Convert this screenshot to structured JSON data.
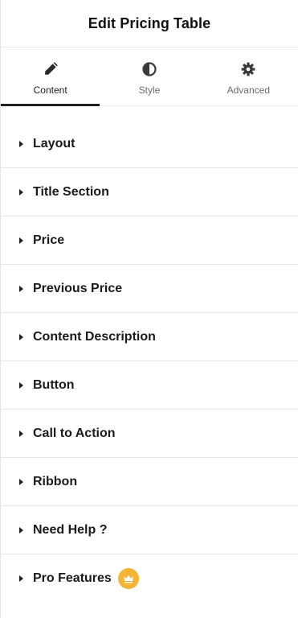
{
  "header": {
    "title": "Edit Pricing Table"
  },
  "tabs": [
    {
      "label": "Content",
      "icon": "pencil-icon",
      "active": true
    },
    {
      "label": "Style",
      "icon": "half-circle-icon",
      "active": false
    },
    {
      "label": "Advanced",
      "icon": "gear-icon",
      "active": false
    }
  ],
  "sections": [
    {
      "label": "Layout"
    },
    {
      "label": "Title Section"
    },
    {
      "label": "Price"
    },
    {
      "label": "Previous Price"
    },
    {
      "label": "Content Description"
    },
    {
      "label": "Button"
    },
    {
      "label": "Call to Action"
    },
    {
      "label": "Ribbon"
    },
    {
      "label": "Need Help ?"
    },
    {
      "label": "Pro Features",
      "badge_icon": "crown-icon"
    }
  ],
  "colors": {
    "pro_badge": "#f5b534",
    "active_tab_underline": "#1f1f1f"
  }
}
